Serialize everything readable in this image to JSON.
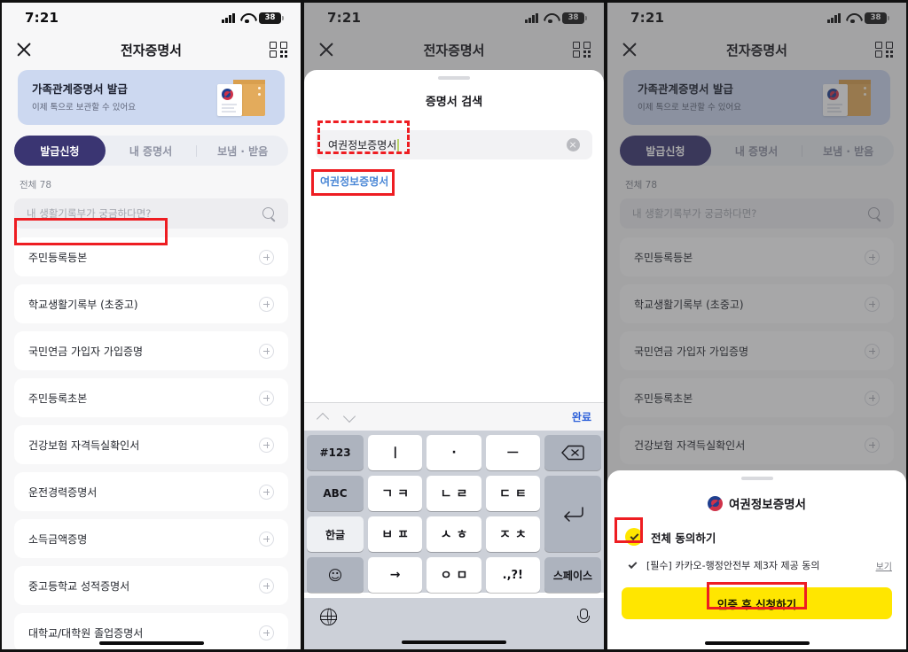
{
  "status_bar": {
    "time": "7:21",
    "battery_level": "38",
    "signal_icon": "cellular-bars-icon",
    "wifi_icon": "wifi-icon"
  },
  "app_header": {
    "title": "전자증명서",
    "close_icon": "close-icon",
    "qr_icon": "qr-scan-icon"
  },
  "banner": {
    "title": "가족관계증명서 발급",
    "subtitle": "이제 톡으로 보관할 수 있어요",
    "art_icon": "document-envelope-illustration"
  },
  "tabs": [
    {
      "label": "발급신청",
      "active": true
    },
    {
      "label": "내 증명서",
      "active": false
    },
    {
      "label": "보냄 · 받음",
      "active": false
    }
  ],
  "list_header": {
    "count_label": "전체 78"
  },
  "search": {
    "placeholder": "내 생활기록부가 궁금하다면?",
    "icon": "search-icon"
  },
  "documents": [
    {
      "name": "주민등록등본"
    },
    {
      "name": "학교생활기록부 (초중고)"
    },
    {
      "name": "국민연금 가입자 가입증명"
    },
    {
      "name": "주민등록초본"
    },
    {
      "name": "건강보험 자격득실확인서"
    },
    {
      "name": "운전경력증명서"
    },
    {
      "name": "소득금액증명"
    },
    {
      "name": "중고등학교 성적증명서"
    },
    {
      "name": "대학교/대학원 졸업증명서"
    }
  ],
  "documents_panel3": [
    {
      "name": "주민등록등본"
    },
    {
      "name": "학교생활기록부 (초중고)"
    },
    {
      "name": "국민연금 가입자 가입증명"
    },
    {
      "name": "주민등록초본"
    },
    {
      "name": "건강보험 자격득실확인서"
    }
  ],
  "search_sheet": {
    "title": "증명서 검색",
    "input_value": "여권정보증명서",
    "clear_icon": "clear-circle-icon",
    "suggestion": "여권정보증명서"
  },
  "keyboard": {
    "toolbar": {
      "up_icon": "chevron-up-icon",
      "down_icon": "chevron-down-icon",
      "done_label": "완료"
    },
    "rows": [
      [
        "#123",
        "ㅣ",
        "·",
        "ㅡ",
        "delete-key-icon"
      ],
      [
        "ABC",
        "ㄱㅋ",
        "ㄴㄹ",
        "ㄷㅌ",
        "return-key-icon"
      ],
      [
        "한글",
        "ㅂㅍ",
        "ㅅㅎ",
        "ㅈㅊ"
      ],
      [
        "emoji-key-icon",
        "→",
        "ㅇㅁ",
        ".,?!",
        "스페이스"
      ]
    ],
    "keys": {
      "num": "#123",
      "abc": "ABC",
      "hangul": "한글",
      "emoji": "emoji-key-icon",
      "vert": "ㅣ",
      "dot": "·",
      "horiz": "ㅡ",
      "gk": "ㄱㅋ",
      "nr": "ㄴㄹ",
      "dt": "ㄷㅌ",
      "bp": "ㅂㅍ",
      "sh": "ㅅㅎ",
      "jc": "ㅈㅊ",
      "arrow": "→",
      "om": "ㅇㅁ",
      "punct": ".,?!",
      "space": "스페이스",
      "delete": "delete-key-icon",
      "return": "return-key-icon"
    },
    "bottom": {
      "globe_icon": "globe-icon",
      "mic_icon": "microphone-icon"
    }
  },
  "consent_sheet": {
    "logo_icon": "korea-gov-taegeuk-icon",
    "title": "여권정보증명서",
    "agree_all_label": "전체 동의하기",
    "agree_all_checked": true,
    "item_label": "[필수] 카카오-행정안전부 제3자 제공 동의",
    "item_view_label": "보기",
    "cta_label": "인증 후 신청하기"
  },
  "annotations": {
    "color": "#ee1d22"
  }
}
